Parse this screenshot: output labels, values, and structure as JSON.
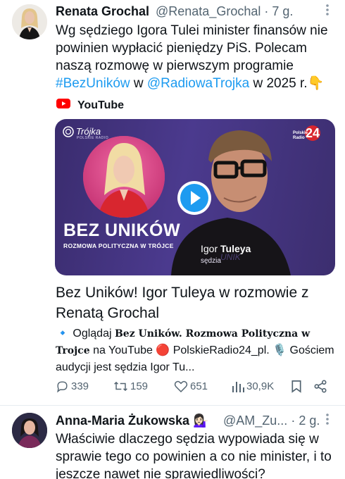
{
  "tweet1": {
    "author_name": "Renata Grochal",
    "handle": "@Renata_Grochal",
    "separator": "·",
    "time": "7 g.",
    "text_part1": "Wg sędziego Igora Tulei minister finansów nie powinien wypłacić pieniędzy PiS. Polecam naszą rozmowę w pierwszym programie ",
    "hashtag": "#BezUników",
    "text_part2": " w ",
    "mention": "@RadiowaTrojka",
    "text_part3": " w 2025 r.",
    "emoji": "👇",
    "more_icon": "more-dots-icon"
  },
  "embed": {
    "source_label": "YouTube",
    "thumbnail": {
      "brand": "Trójka",
      "brand_sub": "POLSKIE RADIO",
      "station": "Polskie\nRadio",
      "station_num": "24",
      "show_title": "BEZ UNIKÓW",
      "show_subtitle": "ROZMOWA POLITYCZNA W TRÓJCE",
      "guest_first": "Igor",
      "guest_last": "Tuleya",
      "guest_role": "sędzia"
    },
    "title": "Bez Uników! Igor Tuleya w rozmowie z Renatą Grochal",
    "desc_bullet": "🔹",
    "desc_pre": " Oglądaj ",
    "desc_bold": "Bez Uników. Rozmowa Polityczna w Trojce",
    "desc_mid": " na YouTube ",
    "desc_red": "🔴",
    "desc_channel": " PolskieRadio24_pl. ",
    "desc_mic": "🎙️",
    "desc_end": " Gościem audycji jest sędzia Igor Tu..."
  },
  "actions": {
    "replies": "339",
    "retweets": "159",
    "likes": "651",
    "views": "30,9K"
  },
  "tweet2": {
    "author_name": "Anna-Maria Żukowska",
    "emoji": "💁🏻‍♀️",
    "handle": "@AM_Zu...",
    "separator": "·",
    "time": "2 g.",
    "text": "Właściwie dlaczego sędzia wypowiada się w sprawie tego co powinien a co nie minister, i to jeszcze nawet nie sprawiedliwości?"
  },
  "colors": {
    "accent": "#1d9bf0",
    "text": "#0f1419",
    "muted": "#536471",
    "card_bg": "#3a2c6e",
    "youtube_red": "#ff0000"
  }
}
